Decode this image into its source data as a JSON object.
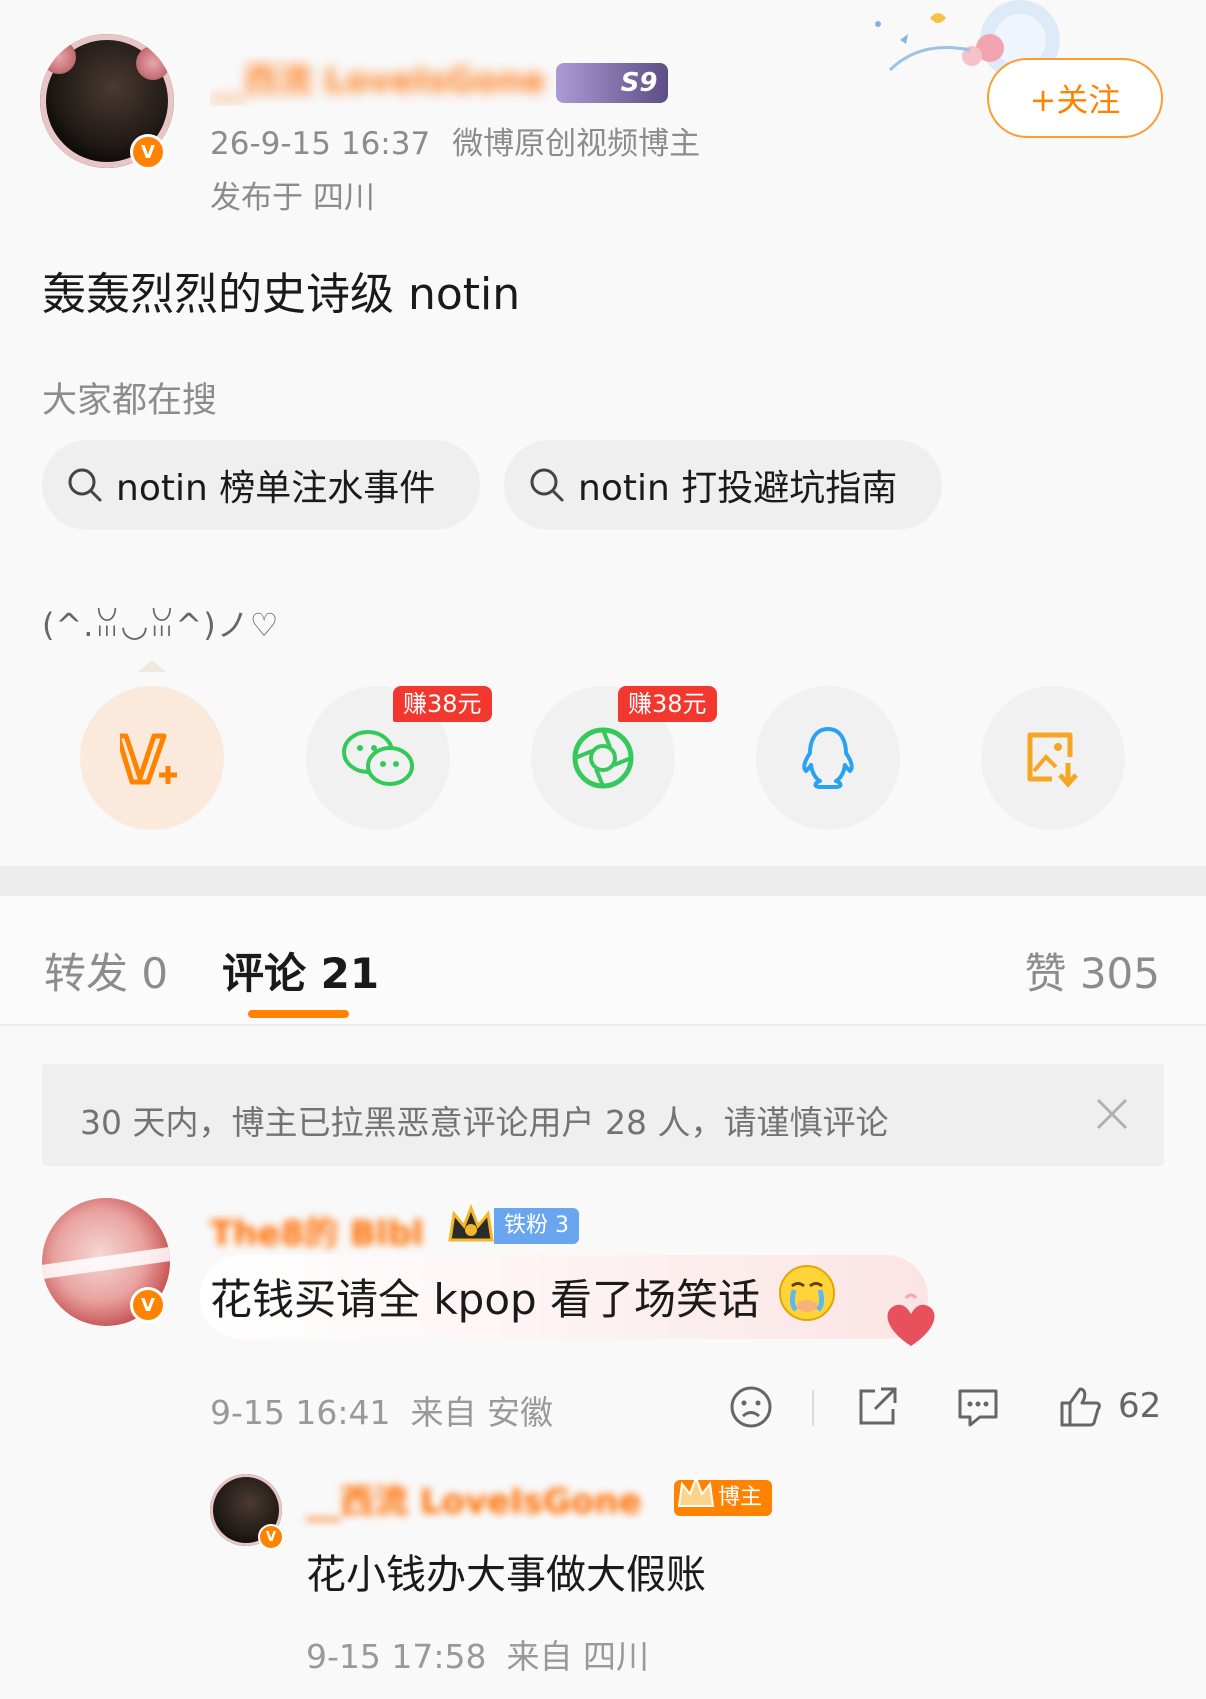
{
  "post": {
    "author_name": "__西流 LoveIsGone",
    "level_badge": "S9",
    "timestamp": "26-9-15 16:37",
    "author_tag": "微博原创视频博主",
    "location": "发布于 四川",
    "follow_label": "+关注",
    "text": "轰轰烈烈的史诗级 notin",
    "search_hint": "大家都在搜",
    "search_chips": [
      {
        "label": "notin 榜单注水事件"
      },
      {
        "label": "notin 打投避坑指南"
      }
    ],
    "kaomoji": "(^.ꈍ◡ꈍ^)ノ♡",
    "share": {
      "earn_badges": [
        "赚38元",
        "赚38元"
      ],
      "targets": [
        "vplus-icon",
        "wechat-icon",
        "moments-icon",
        "qq-icon",
        "save-image-icon"
      ]
    }
  },
  "tabs": {
    "repost": "转发 0",
    "comment": "评论 21",
    "like": "赞 305"
  },
  "notice": {
    "text": "30 天内，博主已拉黑恶意评论用户 28 人，请谨慎评论"
  },
  "comments": [
    {
      "user_name": "The8的 Blbl",
      "fan_badge": "铁粉 3",
      "text": "花钱买请全 kpop 看了场笑话",
      "time": "9-15 16:41",
      "source": "来自 安徽",
      "likes": "62",
      "replies": [
        {
          "user_name": "__西流 LoveIsGone",
          "owner_badge": "博主",
          "text": "花小钱办大事做大假账",
          "time": "9-15 17:58",
          "source": "来自 四川"
        }
      ]
    }
  ],
  "colors": {
    "accent": "#ff8200",
    "name": "#ff6d00",
    "muted": "#8c8c8c",
    "earn_red": "#f2372f",
    "wechat_green": "#35c95b",
    "qq_blue": "#2aa2f0"
  }
}
